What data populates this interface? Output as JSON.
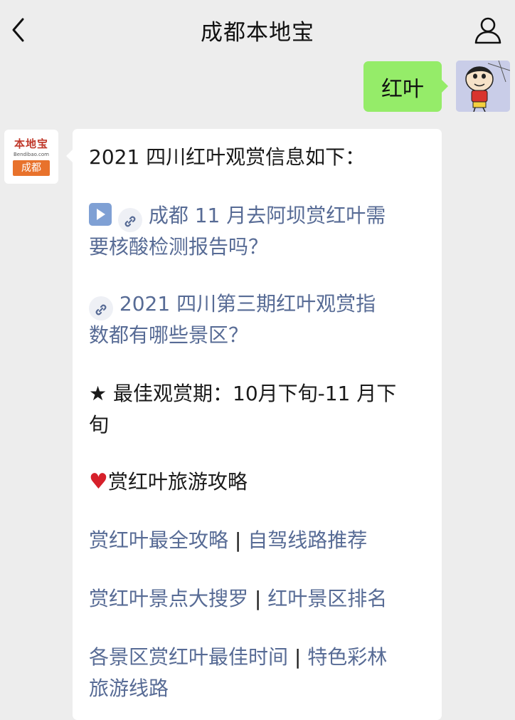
{
  "nav": {
    "title": "成都本地宝"
  },
  "user_message": {
    "text": "红叶"
  },
  "bot_avatar": {
    "logo_main": "本地宝",
    "logo_domain": "Bendibao.com",
    "logo_city": "成都"
  },
  "bot_message": {
    "intro": "2021 四川红叶观赏信息如下：",
    "link1_line1": "成都 11 月去阿坝赏红叶需",
    "link1_line2": "要核酸检测报告吗？",
    "link2_line1": "2021 四川第三期红叶观赏指",
    "link2_line2": "数都有哪些景区？",
    "best_period_line1": "★ 最佳观赏期：10月下旬-11 月下",
    "best_period_line2": "旬",
    "guide_heading": "赏红叶旅游攻略",
    "links_row1": {
      "a": "赏红叶最全攻略",
      "sep": " | ",
      "b": "自驾线路推荐"
    },
    "links_row2": {
      "a": "赏红叶景点大搜罗",
      "sep": " | ",
      "b": "红叶景区排名"
    },
    "links_row3": {
      "a": "各景区赏红叶最佳时间",
      "sep": " | ",
      "b": "特色彩林"
    },
    "links_row3_cont": "旅游线路"
  },
  "colors": {
    "background": "#ededed",
    "user_bubble": "#95ec69",
    "link": "#576b95",
    "logo_orange": "#e8722c"
  },
  "icons": [
    "back-arrow-icon",
    "profile-icon",
    "play-icon",
    "mini-program-link-icon",
    "heart-icon"
  ]
}
